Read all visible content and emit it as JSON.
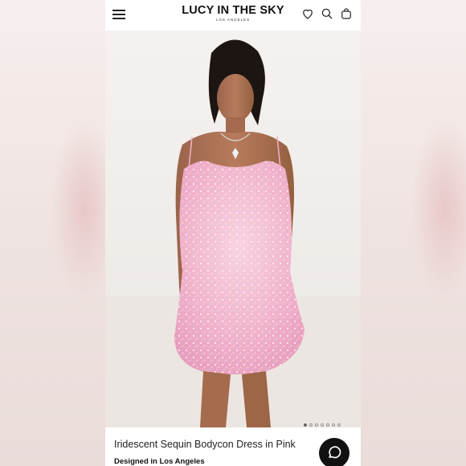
{
  "header": {
    "brand_name": "LUCY IN THE SKY",
    "brand_tagline": "LOS ANGELES",
    "icons": [
      "menu-icon",
      "heart-icon",
      "search-icon",
      "bag-icon"
    ]
  },
  "gallery": {
    "total_images": 7,
    "active_index": 0
  },
  "product": {
    "title": "Iridescent Sequin Bodycon Dress in Pink",
    "designed_label": "Designed in Los Angeles"
  },
  "chat": {
    "icon": "chat-icon"
  },
  "colors": {
    "accent": "#111111",
    "dress_pink": "#f2b6cf",
    "background": "#ffffff"
  }
}
